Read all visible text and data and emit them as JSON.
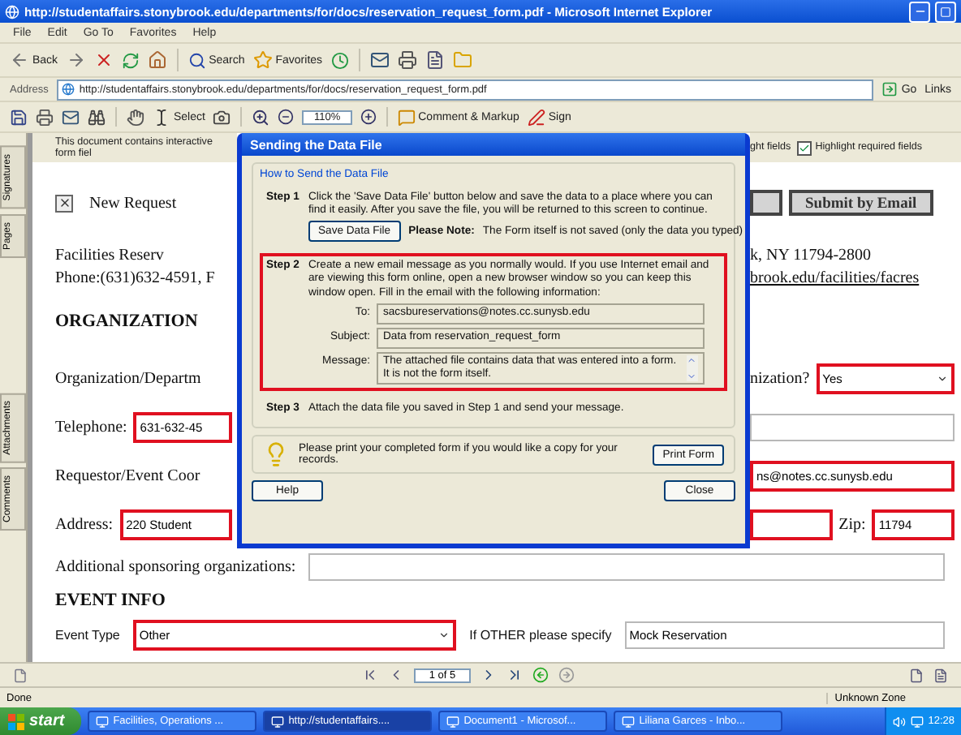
{
  "window": {
    "title": "http://studentaffairs.stonybrook.edu/departments/for/docs/reservation_request_form.pdf - Microsoft Internet Explorer"
  },
  "menu": [
    "File",
    "Edit",
    "Go To",
    "Favorites",
    "Help"
  ],
  "toolbar": {
    "back": "Back",
    "search": "Search",
    "favorites": "Favorites"
  },
  "address": {
    "label": "Address",
    "url": "http://studentaffairs.stonybrook.edu/departments/for/docs/reservation_request_form.pdf",
    "go": "Go",
    "links": "Links"
  },
  "reader_toolbar": {
    "select": "Select",
    "zoom": "110%",
    "comment": "Comment & Markup",
    "sign": "Sign"
  },
  "side_tabs": [
    {
      "label": "Signatures",
      "selected": false
    },
    {
      "label": "Pages",
      "selected": false
    },
    {
      "label": "Attachments",
      "selected": false
    },
    {
      "label": "Comments",
      "selected": false
    }
  ],
  "form": {
    "rows": [
      {
        "left": [
          {
            "kind": "notice",
            "text": "This document contains interactive form fiel"
          }
        ],
        "right": [
          {
            "kind": "notice",
            "text": "ght fields"
          },
          {
            "kind": "tick_checkbox",
            "text": "Highlight required fields",
            "checked": true
          }
        ]
      },
      {
        "left": [
          {
            "kind": "checkbox",
            "text": "New Request",
            "checked": true
          }
        ],
        "right": [
          {
            "kind": "button"
          },
          {
            "kind": "button",
            "text": "Submit by Email"
          }
        ]
      },
      {
        "left": [
          {
            "kind": "text",
            "text": "Facilities Reserv"
          }
        ],
        "right": [
          {
            "kind": "text",
            "text": "k, NY 11794-2800"
          }
        ]
      },
      {
        "left": [
          {
            "kind": "text",
            "text": "Phone:(631)632-4591, F"
          }
        ],
        "right": [
          {
            "kind": "link",
            "text": "brook.edu/facilities/facres"
          }
        ]
      },
      {
        "left": [
          {
            "kind": "heading",
            "text": "ORGANIZATION"
          }
        ],
        "right": []
      },
      {
        "left": [
          {
            "kind": "label",
            "text": "Organization/Departm"
          }
        ],
        "right": [
          {
            "kind": "label",
            "text": "nization?"
          },
          {
            "kind": "select",
            "value": "Yes",
            "required": true
          }
        ]
      },
      {
        "left": [
          {
            "kind": "label",
            "text": "Telephone:"
          },
          {
            "kind": "text_field",
            "value": "631-632-45",
            "required": true
          }
        ],
        "right": [
          {
            "kind": "text_field",
            "required": false
          }
        ]
      },
      {
        "left": [
          {
            "kind": "label",
            "text": "Requestor/Event Coor"
          }
        ],
        "right": [
          {
            "kind": "text_field",
            "value": "ns@notes.cc.sunysb.edu",
            "required": true
          }
        ]
      },
      {
        "left": [
          {
            "kind": "label",
            "text": "Address:"
          },
          {
            "kind": "text_field",
            "value": "220 Student",
            "required": true
          }
        ],
        "right": [
          {
            "kind": "text_field",
            "required": true
          },
          {
            "kind": "label",
            "text": "Zip:"
          },
          {
            "kind": "text_field",
            "value": "11794",
            "required": true
          }
        ]
      }
    ],
    "lower_rows": [
      [
        {
          "kind": "label",
          "text": "Additional sponsoring organizations:"
        },
        {
          "kind": "text_field",
          "required": false
        }
      ],
      [
        {
          "kind": "heading",
          "text": "EVENT INFO"
        }
      ],
      [
        {
          "kind": "caption",
          "text": "Event Type"
        },
        {
          "kind": "select",
          "value": "Other",
          "required": true
        },
        {
          "kind": "caption",
          "text": "If OTHER please specify"
        },
        {
          "kind": "text_field",
          "value": "Mock Reservation",
          "required": false
        }
      ]
    ]
  },
  "dialog": {
    "title": "Sending the Data File",
    "group": "How to Send the Data File",
    "steps": [
      {
        "label": "Step 1",
        "text": "Click the 'Save Data File' button below and save the data to a place where you can find it easily. After you save the file, you will be returned to this screen to continue.",
        "highlighted": false,
        "button": "Save Data File",
        "note_label": "Please Note:",
        "note": "The Form itself is not saved (only the data you typed)"
      },
      {
        "label": "Step 2",
        "text": "Create a new email message as you normally would. If you use Internet email and are viewing this form online, open a new browser window so you can keep this window open. Fill in the email with the following information:",
        "highlighted": true,
        "fields": [
          {
            "label": "To:",
            "value": "sacsbureservations@notes.cc.sunysb.edu",
            "kind": "line"
          },
          {
            "label": "Subject:",
            "value": "Data from reservation_request_form",
            "kind": "line"
          },
          {
            "label": "Message:",
            "value": "The attached file contains data that was entered into a form. It is not the form itself.",
            "kind": "multiline"
          }
        ]
      },
      {
        "label": "Step 3",
        "text": "Attach the data file you saved in Step 1 and send your message.",
        "highlighted": false
      }
    ],
    "print_text": "Please print your completed form if you would like a copy for your records.",
    "print_button": "Print Form",
    "buttons": [
      "Help",
      "Close"
    ]
  },
  "page_nav": {
    "page": "1 of 5"
  },
  "status_bar": {
    "left": "Done",
    "zone": "Unknown Zone"
  },
  "taskbar": {
    "start": "start",
    "tasks": [
      {
        "label": "Facilities, Operations ...",
        "selected": false
      },
      {
        "label": "http://studentaffairs....",
        "selected": true
      },
      {
        "label": "Document1 - Microsof...",
        "selected": false
      },
      {
        "label": "Liliana Garces - Inbo...",
        "selected": false
      }
    ],
    "clock": "12:28"
  }
}
